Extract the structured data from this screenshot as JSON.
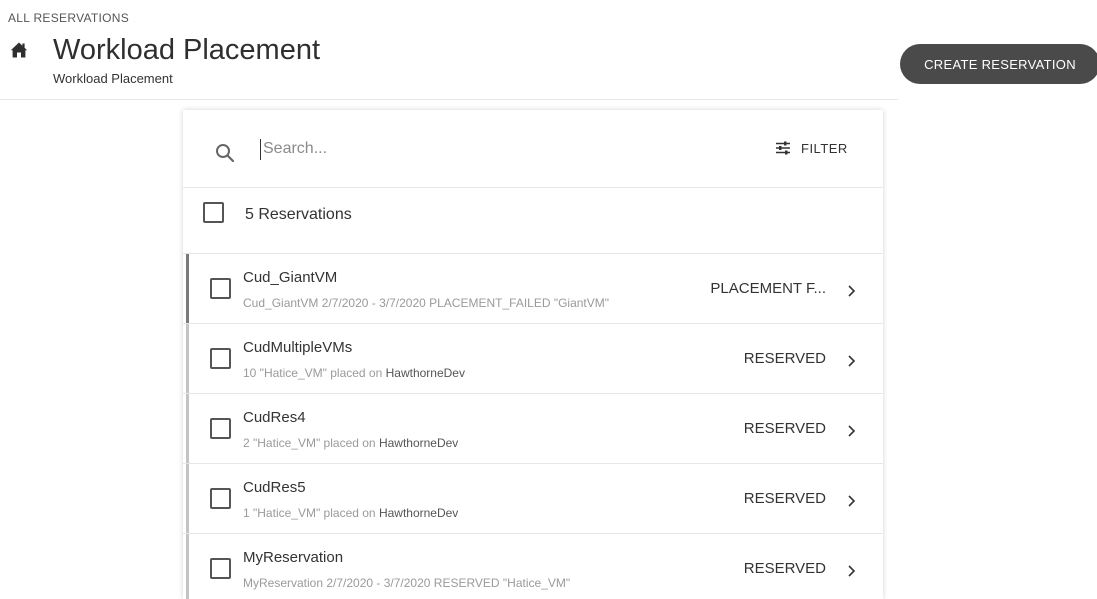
{
  "breadcrumb": "ALL RESERVATIONS",
  "header": {
    "title": "Workload Placement",
    "subtitle": "Workload Placement",
    "icon": "home-icon"
  },
  "actions": {
    "create_label": "CREATE RESERVATION"
  },
  "search": {
    "placeholder": "Search...",
    "value": "",
    "filter_label": "FILTER"
  },
  "list": {
    "count_label": "5 Reservations",
    "rows": [
      {
        "name": "Cud_GiantVM",
        "detail": "Cud_GiantVM 2/7/2020 - 3/7/2020 PLACEMENT_FAILED \"GiantVM\"",
        "status": "PLACEMENT F...",
        "state": "failed"
      },
      {
        "name": "CudMultipleVMs",
        "detail": "10 \"Hatice_VM\" placed on",
        "host": "HawthorneDev",
        "status": "RESERVED",
        "state": "reserved"
      },
      {
        "name": "CudRes4",
        "detail": "2 \"Hatice_VM\" placed on",
        "host": "HawthorneDev",
        "status": "RESERVED",
        "state": "reserved"
      },
      {
        "name": "CudRes5",
        "detail": "1 \"Hatice_VM\" placed on",
        "host": "HawthorneDev",
        "status": "RESERVED",
        "state": "reserved"
      },
      {
        "name": "MyReservation",
        "detail": "MyReservation 2/7/2020 - 3/7/2020 RESERVED \"Hatice_VM\"",
        "status": "RESERVED",
        "state": "reserved"
      }
    ]
  },
  "colors": {
    "button_bg": "#4a4a4a",
    "accent_failed": "#7a7a7a",
    "accent_reserved": "#c4c4c4"
  }
}
